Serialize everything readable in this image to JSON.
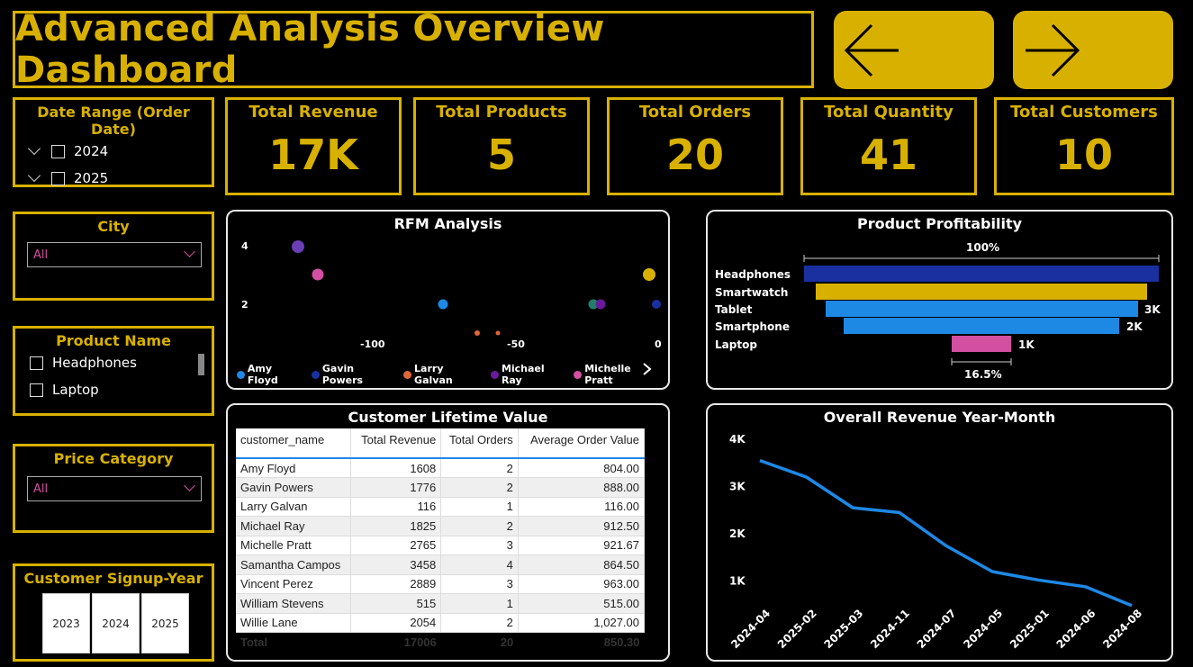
{
  "header": {
    "title": "Advanced Analysis Overview Dashboard",
    "back_icon": "arrow-left-icon",
    "forward_icon": "arrow-right-icon"
  },
  "kpis": [
    {
      "label": "Total Revenue",
      "value": "17K"
    },
    {
      "label": "Total Products",
      "value": "5"
    },
    {
      "label": "Total Orders",
      "value": "20"
    },
    {
      "label": "Total Quantity",
      "value": "41"
    },
    {
      "label": "Total Customers",
      "value": "10"
    }
  ],
  "slicers": {
    "date_range": {
      "title": "Date Range (Order Date)",
      "items": [
        "2024",
        "2025"
      ]
    },
    "city": {
      "title": "City",
      "value": "All"
    },
    "product_name": {
      "title": "Product Name",
      "items": [
        "Headphones",
        "Laptop"
      ]
    },
    "price_category": {
      "title": "Price Category",
      "value": "All"
    },
    "signup_year": {
      "title": "Customer Signup-Year",
      "items": [
        "2023",
        "2024",
        "2025"
      ]
    }
  },
  "rfm": {
    "title": "RFM Analysis",
    "y_ticks": [
      "4",
      "2"
    ],
    "x_ticks": [
      "-100",
      "-50",
      "0"
    ],
    "legend": [
      {
        "name": "Amy Floyd",
        "color": "#1e88e5"
      },
      {
        "name": "Gavin Powers",
        "color": "#1a2fa0"
      },
      {
        "name": "Larry Galvan",
        "color": "#e0663a"
      },
      {
        "name": "Michael Ray",
        "color": "#6a1b9a"
      },
      {
        "name": "Michelle Pratt",
        "color": "#d34fa2"
      }
    ]
  },
  "profitability": {
    "title": "Product Profitability",
    "top_label": "100%",
    "bottom_label": "16.5%",
    "bars": [
      {
        "name": "Headphones",
        "value_label": "",
        "color": "#1a2fa0"
      },
      {
        "name": "Smartwatch",
        "value_label": "",
        "color": "#d8b100"
      },
      {
        "name": "Tablet",
        "value_label": "3K",
        "color": "#1e88e5"
      },
      {
        "name": "Smartphone",
        "value_label": "2K",
        "color": "#1e88e5"
      },
      {
        "name": "Laptop",
        "value_label": "1K",
        "color": "#d34fa2"
      }
    ]
  },
  "clv": {
    "title": "Customer Lifetime Value",
    "columns": [
      "customer_name",
      "Total Revenue",
      "Total Orders",
      "Average Order Value"
    ],
    "rows": [
      [
        "Amy Floyd",
        "1608",
        "2",
        "804.00"
      ],
      [
        "Gavin Powers",
        "1776",
        "2",
        "888.00"
      ],
      [
        "Larry Galvan",
        "116",
        "1",
        "116.00"
      ],
      [
        "Michael Ray",
        "1825",
        "2",
        "912.50"
      ],
      [
        "Michelle Pratt",
        "2765",
        "3",
        "921.67"
      ],
      [
        "Samantha Campos",
        "3458",
        "4",
        "864.50"
      ],
      [
        "Vincent Perez",
        "2889",
        "3",
        "963.00"
      ],
      [
        "William Stevens",
        "515",
        "1",
        "515.00"
      ],
      [
        "Willie Lane",
        "2054",
        "2",
        "1,027.00"
      ]
    ],
    "total": [
      "Total",
      "17006",
      "20",
      "850.30"
    ]
  },
  "chart_data": {
    "type": "line",
    "title": "Overall Revenue Year-Month",
    "categories": [
      "2024-04",
      "2025-02",
      "2025-03",
      "2024-11",
      "2024-07",
      "2024-05",
      "2025-01",
      "2024-06",
      "2024-08"
    ],
    "series": [
      {
        "values": [
          3550,
          3200,
          2550,
          2450,
          1750,
          1200,
          1020,
          880,
          480
        ]
      }
    ],
    "y_ticks": [
      "4K",
      "3K",
      "2K",
      "1K"
    ],
    "ylim": [
      0,
      4000
    ],
    "color": "#1e88e5",
    "grid": false
  }
}
